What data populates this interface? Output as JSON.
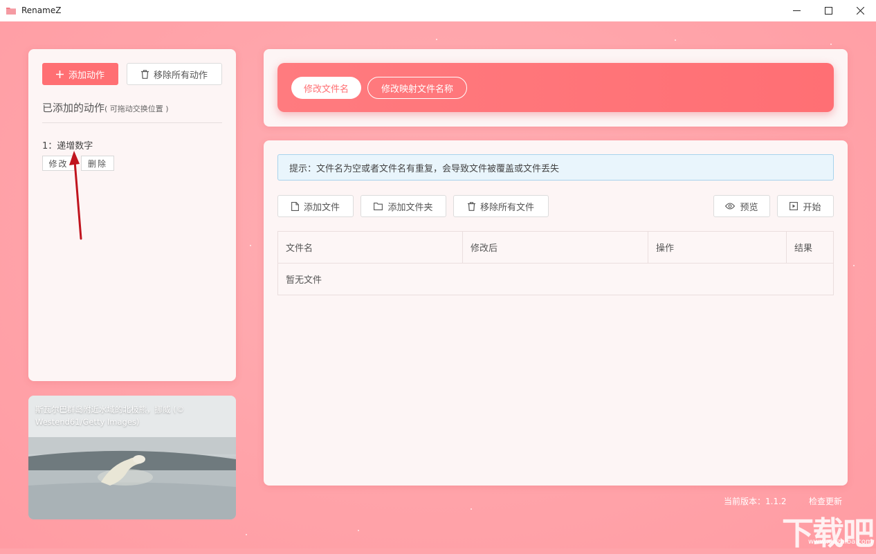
{
  "window": {
    "title": "RenameZ"
  },
  "left": {
    "add_action": "添加动作",
    "remove_all_actions": "移除所有动作",
    "section_title": "已添加的动作",
    "section_hint": "( 可拖动交换位置 )",
    "actions": [
      {
        "label": "1：递增数字",
        "edit": "修改",
        "delete": "删除"
      }
    ]
  },
  "image_card": {
    "caption": "斯瓦尔巴群岛附近水域的北极熊，挪威 (© Westend61/Getty Images)"
  },
  "tabs": [
    {
      "label": "修改文件名",
      "active": true
    },
    {
      "label": "修改映射文件名称",
      "active": false
    }
  ],
  "notice": "提示：文件名为空或者文件名有重复，会导致文件被覆盖或文件丢失",
  "toolbar": {
    "add_file": "添加文件",
    "add_folder": "添加文件夹",
    "remove_all_files": "移除所有文件",
    "preview": "预览",
    "start": "开始"
  },
  "table": {
    "columns": [
      "文件名",
      "修改后",
      "操作",
      "结果"
    ],
    "empty": "暂无文件"
  },
  "footer": {
    "version": "当前版本：1.1.2",
    "check_update": "检查更新"
  },
  "watermark": {
    "text": "下载吧",
    "url": "www.xiazaiba.com"
  },
  "colors": {
    "accent": "#ff6f73",
    "background": "#ffa4aa",
    "panel": "#fdf5f5"
  }
}
